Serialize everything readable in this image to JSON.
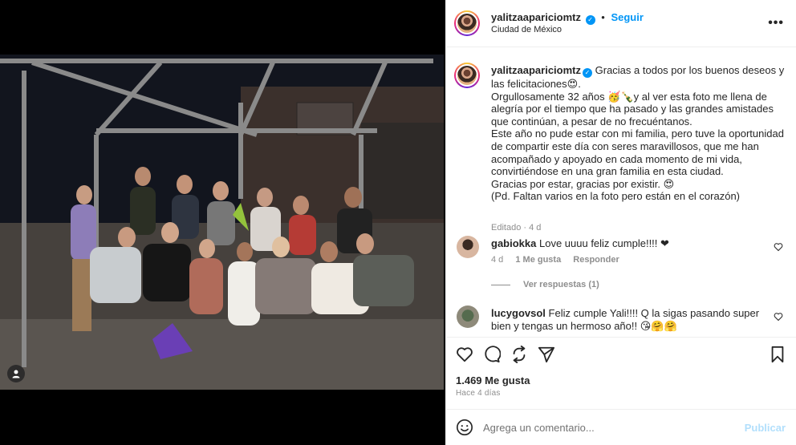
{
  "post": {
    "username": "yalitzaapariciomtz",
    "follow_label": "Seguir",
    "dot": "•",
    "location": "Ciudad de México",
    "more_label": "•••"
  },
  "caption": {
    "username": "yalitzaapariciomtz",
    "text": "Gracias a todos por los buenos deseos y las felicitaciones😍.\nOrgullosamente 32 años 🥳🍾y al ver esta foto me llena de alegría por el tiempo que ha pasado y las grandes amistades que continúan, a pesar de no frecuéntanos.\nEste año no pude estar con mi familia, pero tuve la oportunidad de compartir este día con seres maravillosos, que me han acompañado y apoyado en cada momento de mi vida, convirtiéndose en una gran familia en esta ciudad.\nGracias por estar, gracias por existir. 😍\n(Pd. Faltan varios en la foto pero están en el corazón)",
    "edited_label": "Editado",
    "edited_time": "4 d"
  },
  "comments": [
    {
      "username": "gabiokka",
      "text": "Love uuuu feliz cumple!!!! ❤",
      "time": "4 d",
      "likes": "1 Me gusta",
      "reply": "Responder",
      "view_replies": "Ver respuestas (1)"
    },
    {
      "username": "lucygovsol",
      "text": "Feliz cumple Yali!!!! Q la sigas pasando super bien y tengas un hermoso año!! 😘🤗🤗"
    }
  ],
  "stats": {
    "likes": "1.469 Me gusta",
    "time_ago": "Hace 4 días"
  },
  "add_comment": {
    "placeholder": "Agrega un comentario...",
    "publish": "Publicar"
  },
  "colors": {
    "accent": "#0095f6",
    "publish_disabled": "#b2dffc",
    "muted": "#8e8e8e",
    "text": "#262626"
  },
  "icons": [
    "heart-icon",
    "comment-icon",
    "share-icon",
    "send-icon",
    "bookmark-icon",
    "emoji-icon",
    "user-tag-icon",
    "verified-badge-icon"
  ]
}
